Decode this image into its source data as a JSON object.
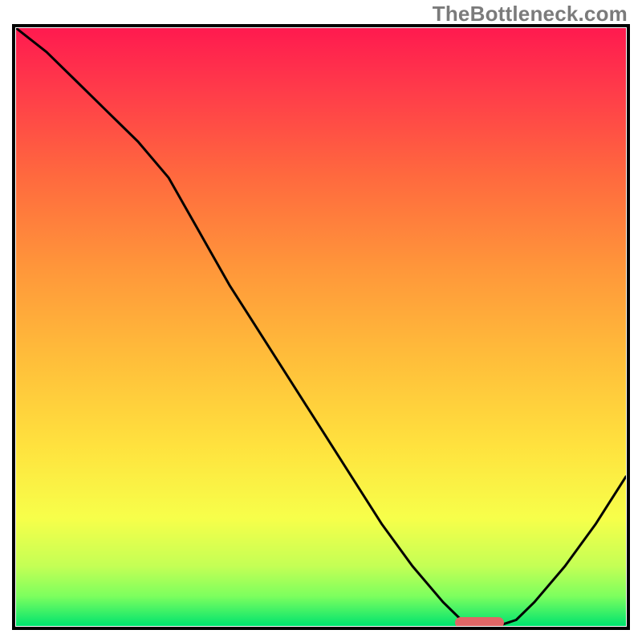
{
  "watermark": "TheBottleneck.com",
  "chart_data": {
    "type": "line",
    "title": "",
    "xlabel": "",
    "ylabel": "",
    "xlim": [
      0,
      100
    ],
    "ylim": [
      0,
      100
    ],
    "grid": false,
    "legend": false,
    "background_gradient": {
      "from_color": "#ff1a4f",
      "to_color": "#00e36f",
      "direction": "vertical"
    },
    "series": [
      {
        "name": "bottleneck-curve",
        "color": "#000000",
        "x": [
          0,
          5,
          10,
          15,
          20,
          25,
          30,
          35,
          40,
          45,
          50,
          55,
          60,
          65,
          70,
          73,
          76,
          79,
          82,
          85,
          90,
          95,
          100
        ],
        "y": [
          100,
          96,
          91,
          86,
          81,
          75,
          66,
          57,
          49,
          41,
          33,
          25,
          17,
          10,
          4,
          1,
          0,
          0,
          1,
          4,
          10,
          17,
          25
        ]
      }
    ],
    "marker": {
      "name": "optimal-range-pill",
      "color": "#e06666",
      "x_start": 72,
      "x_end": 80,
      "y": 0.5
    }
  }
}
